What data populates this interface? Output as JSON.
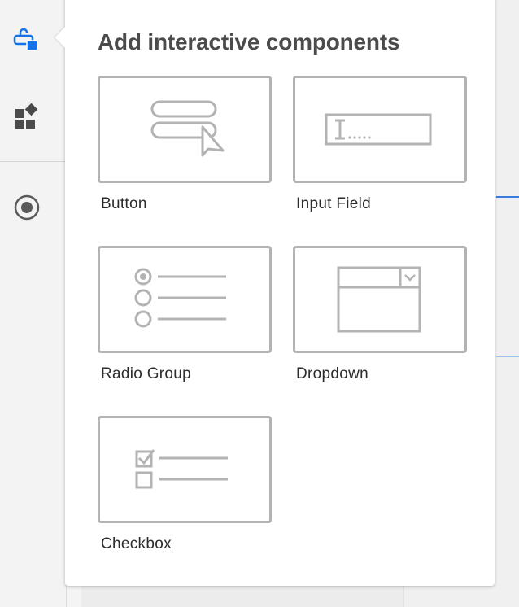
{
  "popover": {
    "title": "Add interactive components",
    "components": [
      {
        "label": "Button",
        "icon": "button-component-icon"
      },
      {
        "label": "Input Field",
        "icon": "input-field-component-icon"
      },
      {
        "label": "Radio Group",
        "icon": "radio-group-component-icon"
      },
      {
        "label": "Dropdown",
        "icon": "dropdown-component-icon"
      },
      {
        "label": "Checkbox",
        "icon": "checkbox-component-icon"
      }
    ]
  },
  "rail": {
    "items": [
      {
        "icon": "interactive-components-icon",
        "active": true
      },
      {
        "icon": "widgets-icon",
        "active": false
      },
      {
        "icon": "record-icon",
        "active": false
      }
    ]
  },
  "colors": {
    "accent": "#1473e6",
    "tile_border": "#b3b3b3",
    "title": "#4b4b4b"
  }
}
